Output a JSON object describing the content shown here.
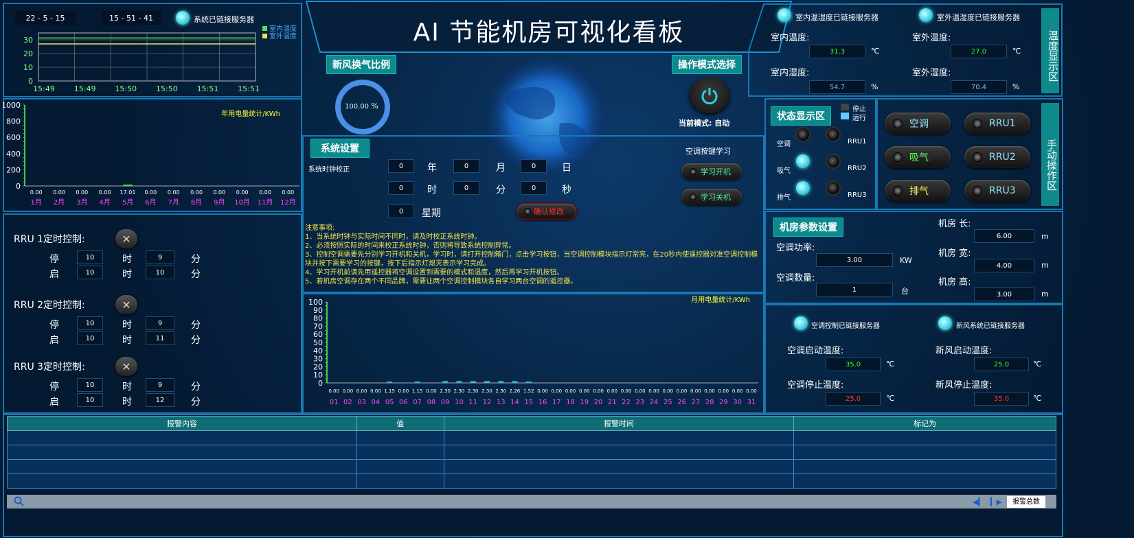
{
  "title": "AI 节能机房可视化看板",
  "clock": {
    "date": "22 - 5 - 15",
    "time": "15 - 51 - 41",
    "server_status": "系统已链接服务器"
  },
  "temp_chart": {
    "type": "line",
    "legend": [
      "室内温度",
      "室外温度"
    ],
    "colors": {
      "indoor": "#55e055",
      "outdoor": "#e8e855"
    },
    "y_ticks": [
      "30",
      "20",
      "10",
      "0"
    ],
    "x_ticks": [
      "15:49",
      "15:49",
      "15:50",
      "15:50",
      "15:51",
      "15:51"
    ],
    "series": [
      {
        "name": "室内温度",
        "values": [
          31.3,
          31.3,
          31.3,
          31.3,
          31.3,
          31.3
        ]
      },
      {
        "name": "室外温度",
        "values": [
          27.0,
          27.0,
          27.0,
          27.0,
          27.0,
          27.0
        ]
      }
    ],
    "ylim": [
      0,
      35
    ]
  },
  "chart_data": [
    {
      "type": "bar",
      "title": "年用电量统计/KWh",
      "ylim": [
        0,
        1000
      ],
      "y_ticks": [
        "1000",
        "800",
        "600",
        "400",
        "200",
        "0"
      ],
      "categories": [
        "1月",
        "2月",
        "3月",
        "4月",
        "5月",
        "6月",
        "7月",
        "8月",
        "9月",
        "10月",
        "11月",
        "12月"
      ],
      "value_labels": [
        "0.00",
        "0.00",
        "0.00",
        "0.00",
        "17.01",
        "0.00",
        "0.00",
        "0.00",
        "0.00",
        "0.00",
        "0.00",
        "0.00"
      ],
      "values": [
        0,
        0,
        0,
        0,
        17.01,
        0,
        0,
        0,
        0,
        0,
        0,
        0
      ]
    },
    {
      "type": "bar",
      "title": "月用电量统计/KWh",
      "ylim": [
        0,
        100
      ],
      "y_ticks": [
        "100",
        "90",
        "80",
        "70",
        "60",
        "50",
        "40",
        "30",
        "20",
        "10",
        "0"
      ],
      "categories": [
        "01",
        "02",
        "03",
        "04",
        "05",
        "06",
        "07",
        "08",
        "09",
        "10",
        "11",
        "12",
        "13",
        "14",
        "15",
        "16",
        "17",
        "18",
        "19",
        "20",
        "21",
        "22",
        "23",
        "24",
        "25",
        "26",
        "27",
        "28",
        "29",
        "30",
        "31"
      ],
      "value_labels": [
        "0.00",
        "0.00",
        "0.00",
        "0.00",
        "1.15",
        "0.00",
        "1.15",
        "0.00",
        "2.30",
        "2.30",
        "2.30",
        "2.30",
        "2.30",
        "2.26",
        "1.52",
        "0.00",
        "0.00",
        "0.00",
        "0.00",
        "0.00",
        "0.00",
        "0.00",
        "0.00",
        "0.00",
        "0.00",
        "0.00",
        "0.00",
        "0.00",
        "0.00",
        "0.00",
        "0.00"
      ],
      "values": [
        0,
        0,
        0,
        0,
        1.15,
        0,
        1.15,
        0,
        2.3,
        2.3,
        2.3,
        2.3,
        2.3,
        2.26,
        1.52,
        0,
        0,
        0,
        0,
        0,
        0,
        0,
        0,
        0,
        0,
        0,
        0,
        0,
        0,
        0,
        0
      ]
    }
  ],
  "rru_timers": [
    {
      "title": "RRU 1定时控制:",
      "stop_label": "停",
      "start_label": "启",
      "stop_h": "10",
      "stop_m": "9",
      "start_h": "10",
      "start_m": "10"
    },
    {
      "title": "RRU 2定时控制:",
      "stop_label": "停",
      "start_label": "启",
      "stop_h": "10",
      "stop_m": "9",
      "start_h": "10",
      "start_m": "11"
    },
    {
      "title": "RRU 3定时控制:",
      "stop_label": "停",
      "start_label": "启",
      "stop_h": "10",
      "stop_m": "9",
      "start_h": "10",
      "start_m": "12"
    }
  ],
  "units": {
    "hour": "时",
    "minute": "分",
    "second": "秒",
    "year": "年",
    "month": "月",
    "day": "日",
    "week": "星期",
    "celsius": "℃",
    "percent": "%",
    "kw": "KW",
    "tai": "台",
    "m": "m"
  },
  "fresh_air": {
    "label": "新风换气比例",
    "value": "100.00",
    "unit": "%",
    "ratio": 1.0
  },
  "mode": {
    "label": "操作模式选择",
    "current": "当前模式: 自动"
  },
  "settings": {
    "label": "系统设置",
    "clock_label": "系统时钟校正",
    "year": "0",
    "month": "0",
    "day": "0",
    "hour": "0",
    "minute": "0",
    "second": "0",
    "week": "0",
    "learn_label": "空调按键学习",
    "learn_on": "学习开机",
    "learn_off": "学习关机",
    "confirm": "确认修改"
  },
  "notes": {
    "title": "注意事项:",
    "lines": [
      "1、当系统时钟与实际时间不同时，请及时校正系统时钟。",
      "2、必须按照实际的时间来校正系统时钟，否则将导致系统控制异常。",
      "3、控制空调需要先分别学习开机和关机，学习时，请打开控制箱门，点击学习按钮，当空调控制模块指示灯常亮，在20秒内使遥控器对准空调控制模块并按下需要学习的按键，按下后指示灯熄灭表示学习完成。",
      "4、学习开机前请先用遥控器将空调设置到需要的模式和温度，然后再学习开机按钮。",
      "5、若机房空调存在两个不同品牌，需要让两个空调控制模块各自学习两台空调的遥控器。"
    ]
  },
  "temp_display": {
    "side_label": "温度显示区",
    "indoor_server": "室内温湿度已链接服务器",
    "outdoor_server": "室外温湿度已链接服务器",
    "indoor_temp_label": "室内温度:",
    "indoor_temp": "31.3",
    "outdoor_temp_label": "室外温度:",
    "outdoor_temp": "27.0",
    "indoor_hum_label": "室内湿度:",
    "indoor_hum": "54.7",
    "outdoor_hum_label": "室外湿度:",
    "outdoor_hum": "70.4"
  },
  "status": {
    "label": "状态显示区",
    "legend_stop": "停止",
    "legend_run": "运行",
    "ac": "空调",
    "intake": "吸气",
    "exhaust": "排气",
    "rru1": "RRU1",
    "rru2": "RRU2",
    "rru3": "RRU3"
  },
  "manual": {
    "side_label": "手动操作区",
    "ac": "空调",
    "intake": "吸气",
    "exhaust": "排气",
    "rru1": "RRU1",
    "rru2": "RRU2",
    "rru3": "RRU3"
  },
  "room": {
    "label": "机房参数设置",
    "power_label": "空调功率:",
    "power": "3.00",
    "count_label": "空调数量:",
    "count": "1",
    "length_label": "机房 长:",
    "length": "6.00",
    "width_label": "机房 宽:",
    "width": "4.00",
    "height_label": "机房 高:",
    "height": "3.00"
  },
  "thresholds": {
    "ac_server": "空调控制已链接服务器",
    "fresh_server": "新风系统已链接服务器",
    "ac_start_label": "空调启动温度:",
    "ac_start": "35.0",
    "ac_stop_label": "空调停止温度:",
    "ac_stop": "25.0",
    "fresh_start_label": "新风启动温度:",
    "fresh_start": "25.0",
    "fresh_stop_label": "新风停止温度:",
    "fresh_stop": "35.0"
  },
  "alarm": {
    "headers": [
      "报警内容",
      "值",
      "报警时间",
      "标记为"
    ],
    "summary_button": "报警总数"
  }
}
